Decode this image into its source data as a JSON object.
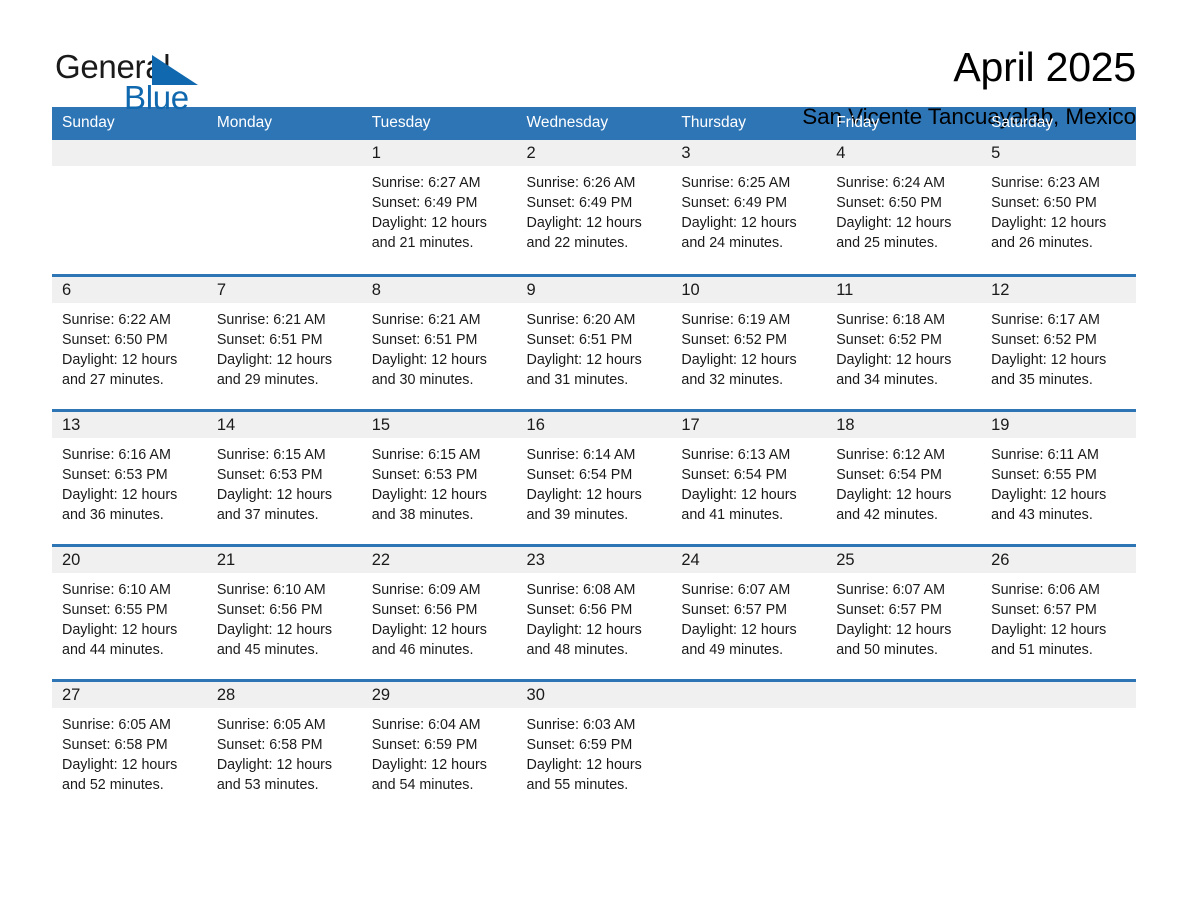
{
  "logo": {
    "word1": "General",
    "word2": "Blue",
    "triangle_color": "#1068ae",
    "icon": "triangle-icon"
  },
  "header": {
    "title": "April 2025",
    "subtitle": "San Vicente Tancuayalab, Mexico"
  },
  "theme": {
    "header_blue": "#2e75b6",
    "row_rule_blue": "#2e75b6",
    "daynum_band": "#f0f0f0",
    "text": "#1a1a1a"
  },
  "weekdays": [
    "Sunday",
    "Monday",
    "Tuesday",
    "Wednesday",
    "Thursday",
    "Friday",
    "Saturday"
  ],
  "weeks": [
    [
      {
        "day": "",
        "empty": true
      },
      {
        "day": "",
        "empty": true
      },
      {
        "day": "1",
        "sunrise": "Sunrise: 6:27 AM",
        "sunset": "Sunset: 6:49 PM",
        "daylight1": "Daylight: 12 hours",
        "daylight2": "and 21 minutes."
      },
      {
        "day": "2",
        "sunrise": "Sunrise: 6:26 AM",
        "sunset": "Sunset: 6:49 PM",
        "daylight1": "Daylight: 12 hours",
        "daylight2": "and 22 minutes."
      },
      {
        "day": "3",
        "sunrise": "Sunrise: 6:25 AM",
        "sunset": "Sunset: 6:49 PM",
        "daylight1": "Daylight: 12 hours",
        "daylight2": "and 24 minutes."
      },
      {
        "day": "4",
        "sunrise": "Sunrise: 6:24 AM",
        "sunset": "Sunset: 6:50 PM",
        "daylight1": "Daylight: 12 hours",
        "daylight2": "and 25 minutes."
      },
      {
        "day": "5",
        "sunrise": "Sunrise: 6:23 AM",
        "sunset": "Sunset: 6:50 PM",
        "daylight1": "Daylight: 12 hours",
        "daylight2": "and 26 minutes."
      }
    ],
    [
      {
        "day": "6",
        "sunrise": "Sunrise: 6:22 AM",
        "sunset": "Sunset: 6:50 PM",
        "daylight1": "Daylight: 12 hours",
        "daylight2": "and 27 minutes."
      },
      {
        "day": "7",
        "sunrise": "Sunrise: 6:21 AM",
        "sunset": "Sunset: 6:51 PM",
        "daylight1": "Daylight: 12 hours",
        "daylight2": "and 29 minutes."
      },
      {
        "day": "8",
        "sunrise": "Sunrise: 6:21 AM",
        "sunset": "Sunset: 6:51 PM",
        "daylight1": "Daylight: 12 hours",
        "daylight2": "and 30 minutes."
      },
      {
        "day": "9",
        "sunrise": "Sunrise: 6:20 AM",
        "sunset": "Sunset: 6:51 PM",
        "daylight1": "Daylight: 12 hours",
        "daylight2": "and 31 minutes."
      },
      {
        "day": "10",
        "sunrise": "Sunrise: 6:19 AM",
        "sunset": "Sunset: 6:52 PM",
        "daylight1": "Daylight: 12 hours",
        "daylight2": "and 32 minutes."
      },
      {
        "day": "11",
        "sunrise": "Sunrise: 6:18 AM",
        "sunset": "Sunset: 6:52 PM",
        "daylight1": "Daylight: 12 hours",
        "daylight2": "and 34 minutes."
      },
      {
        "day": "12",
        "sunrise": "Sunrise: 6:17 AM",
        "sunset": "Sunset: 6:52 PM",
        "daylight1": "Daylight: 12 hours",
        "daylight2": "and 35 minutes."
      }
    ],
    [
      {
        "day": "13",
        "sunrise": "Sunrise: 6:16 AM",
        "sunset": "Sunset: 6:53 PM",
        "daylight1": "Daylight: 12 hours",
        "daylight2": "and 36 minutes."
      },
      {
        "day": "14",
        "sunrise": "Sunrise: 6:15 AM",
        "sunset": "Sunset: 6:53 PM",
        "daylight1": "Daylight: 12 hours",
        "daylight2": "and 37 minutes."
      },
      {
        "day": "15",
        "sunrise": "Sunrise: 6:15 AM",
        "sunset": "Sunset: 6:53 PM",
        "daylight1": "Daylight: 12 hours",
        "daylight2": "and 38 minutes."
      },
      {
        "day": "16",
        "sunrise": "Sunrise: 6:14 AM",
        "sunset": "Sunset: 6:54 PM",
        "daylight1": "Daylight: 12 hours",
        "daylight2": "and 39 minutes."
      },
      {
        "day": "17",
        "sunrise": "Sunrise: 6:13 AM",
        "sunset": "Sunset: 6:54 PM",
        "daylight1": "Daylight: 12 hours",
        "daylight2": "and 41 minutes."
      },
      {
        "day": "18",
        "sunrise": "Sunrise: 6:12 AM",
        "sunset": "Sunset: 6:54 PM",
        "daylight1": "Daylight: 12 hours",
        "daylight2": "and 42 minutes."
      },
      {
        "day": "19",
        "sunrise": "Sunrise: 6:11 AM",
        "sunset": "Sunset: 6:55 PM",
        "daylight1": "Daylight: 12 hours",
        "daylight2": "and 43 minutes."
      }
    ],
    [
      {
        "day": "20",
        "sunrise": "Sunrise: 6:10 AM",
        "sunset": "Sunset: 6:55 PM",
        "daylight1": "Daylight: 12 hours",
        "daylight2": "and 44 minutes."
      },
      {
        "day": "21",
        "sunrise": "Sunrise: 6:10 AM",
        "sunset": "Sunset: 6:56 PM",
        "daylight1": "Daylight: 12 hours",
        "daylight2": "and 45 minutes."
      },
      {
        "day": "22",
        "sunrise": "Sunrise: 6:09 AM",
        "sunset": "Sunset: 6:56 PM",
        "daylight1": "Daylight: 12 hours",
        "daylight2": "and 46 minutes."
      },
      {
        "day": "23",
        "sunrise": "Sunrise: 6:08 AM",
        "sunset": "Sunset: 6:56 PM",
        "daylight1": "Daylight: 12 hours",
        "daylight2": "and 48 minutes."
      },
      {
        "day": "24",
        "sunrise": "Sunrise: 6:07 AM",
        "sunset": "Sunset: 6:57 PM",
        "daylight1": "Daylight: 12 hours",
        "daylight2": "and 49 minutes."
      },
      {
        "day": "25",
        "sunrise": "Sunrise: 6:07 AM",
        "sunset": "Sunset: 6:57 PM",
        "daylight1": "Daylight: 12 hours",
        "daylight2": "and 50 minutes."
      },
      {
        "day": "26",
        "sunrise": "Sunrise: 6:06 AM",
        "sunset": "Sunset: 6:57 PM",
        "daylight1": "Daylight: 12 hours",
        "daylight2": "and 51 minutes."
      }
    ],
    [
      {
        "day": "27",
        "sunrise": "Sunrise: 6:05 AM",
        "sunset": "Sunset: 6:58 PM",
        "daylight1": "Daylight: 12 hours",
        "daylight2": "and 52 minutes."
      },
      {
        "day": "28",
        "sunrise": "Sunrise: 6:05 AM",
        "sunset": "Sunset: 6:58 PM",
        "daylight1": "Daylight: 12 hours",
        "daylight2": "and 53 minutes."
      },
      {
        "day": "29",
        "sunrise": "Sunrise: 6:04 AM",
        "sunset": "Sunset: 6:59 PM",
        "daylight1": "Daylight: 12 hours",
        "daylight2": "and 54 minutes."
      },
      {
        "day": "30",
        "sunrise": "Sunrise: 6:03 AM",
        "sunset": "Sunset: 6:59 PM",
        "daylight1": "Daylight: 12 hours",
        "daylight2": "and 55 minutes."
      },
      {
        "day": "",
        "empty": true
      },
      {
        "day": "",
        "empty": true
      },
      {
        "day": "",
        "empty": true
      }
    ]
  ]
}
